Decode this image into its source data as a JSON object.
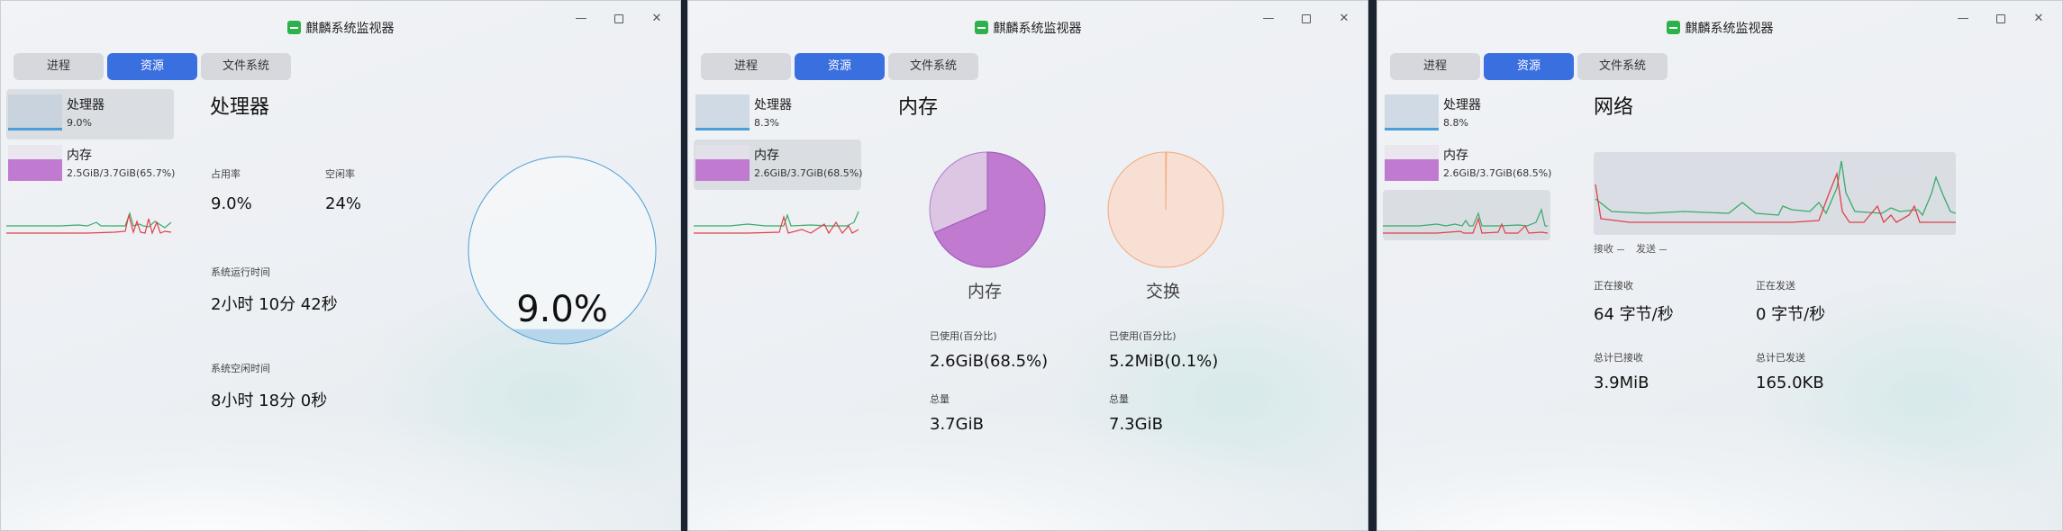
{
  "app": {
    "title": "麒麟系统监视器"
  },
  "window_controls": {
    "min": "—",
    "close": "✕"
  },
  "tabs": [
    "进程",
    "资源",
    "文件系统"
  ],
  "windows": [
    {
      "sidebar": [
        {
          "name": "处理器",
          "value": "9.0%"
        },
        {
          "name": "内存",
          "value": "2.5GiB/3.7GiB(65.7%)"
        }
      ],
      "cpu": {
        "title": "处理器",
        "usage_label": "占用率",
        "usage_value": "9.0%",
        "idle_label": "空闲率",
        "idle_value": "24%",
        "uptime_label": "系统运行时间",
        "uptime_value": "2小时 10分 42秒",
        "idletime_label": "系统空闲时间",
        "idletime_value": "8小时 18分 0秒",
        "gauge_value": "9.0%",
        "gauge_percent": 9.0
      }
    },
    {
      "sidebar": [
        {
          "name": "处理器",
          "value": "8.3%"
        },
        {
          "name": "内存",
          "value": "2.6GiB/3.7GiB(68.5%)"
        }
      ],
      "memory": {
        "title": "内存",
        "mem_label": "内存",
        "swap_label": "交换",
        "mem_used_label": "已使用(百分比)",
        "mem_used_value": "2.6GiB(68.5%)",
        "mem_total_label": "总量",
        "mem_total_value": "3.7GiB",
        "swap_used_label": "已使用(百分比)",
        "swap_used_value": "5.2MiB(0.1%)",
        "swap_total_label": "总量",
        "swap_total_value": "7.3GiB",
        "mem_percent": 68.5,
        "swap_percent": 0.1,
        "mem_color": "#c07ad0",
        "swap_color": "#f3a97a"
      }
    },
    {
      "sidebar": [
        {
          "name": "处理器",
          "value": "8.8%"
        },
        {
          "name": "内存",
          "value": "2.6GiB/3.7GiB(68.5%)"
        }
      ],
      "network": {
        "title": "网络",
        "recv_legend": "接收",
        "send_legend": "发送",
        "recv_rate_label": "正在接收",
        "recv_rate_value": "64 字节/秒",
        "send_rate_label": "正在发送",
        "send_rate_value": "0 字节/秒",
        "recv_total_label": "总计已接收",
        "recv_total_value": "3.9MiB",
        "send_total_label": "总计已发送",
        "send_total_value": "165.0KB"
      }
    }
  ],
  "colors": {
    "accent": "#3a6fe0",
    "recv_line": "#3aaa6a",
    "send_line": "#e0404a",
    "cpu_gauge": "#4a9fd8"
  }
}
